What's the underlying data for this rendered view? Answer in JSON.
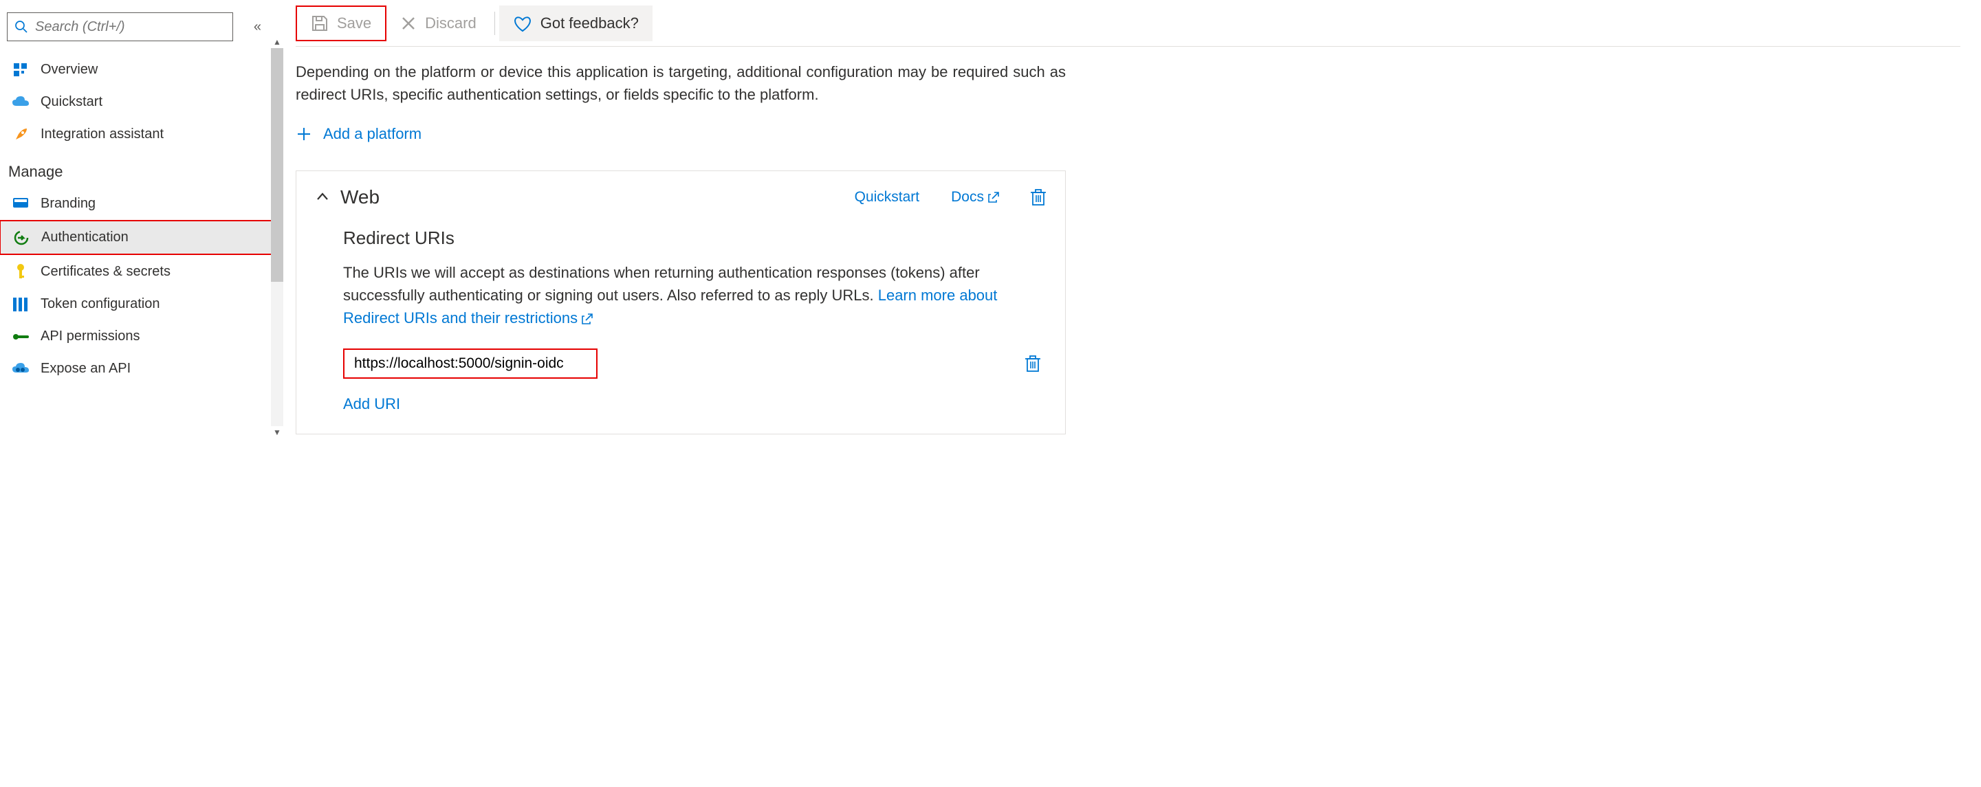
{
  "search": {
    "placeholder": "Search (Ctrl+/)"
  },
  "sidebar": {
    "items": [
      {
        "label": "Overview"
      },
      {
        "label": "Quickstart"
      },
      {
        "label": "Integration assistant"
      }
    ],
    "manage_header": "Manage",
    "manage_items": [
      {
        "label": "Branding"
      },
      {
        "label": "Authentication"
      },
      {
        "label": "Certificates & secrets"
      },
      {
        "label": "Token configuration"
      },
      {
        "label": "API permissions"
      },
      {
        "label": "Expose an API"
      }
    ]
  },
  "toolbar": {
    "save_label": "Save",
    "discard_label": "Discard",
    "feedback_label": "Got feedback?"
  },
  "content": {
    "description": "Depending on the platform or device this application is targeting, additional configuration may be required such as redirect URIs, specific authentication settings, or fields specific to the platform.",
    "add_platform": "Add a platform"
  },
  "web_card": {
    "title": "Web",
    "quickstart": "Quickstart",
    "docs": "Docs",
    "section_title": "Redirect URIs",
    "section_body": "The URIs we will accept as destinations when returning authentication responses (tokens) after successfully authenticating or signing out users. Also referred to as reply URLs. ",
    "learn_more": "Learn more about Redirect URIs and their restrictions",
    "uri_value": "https://localhost:5000/signin-oidc",
    "add_uri": "Add URI"
  }
}
